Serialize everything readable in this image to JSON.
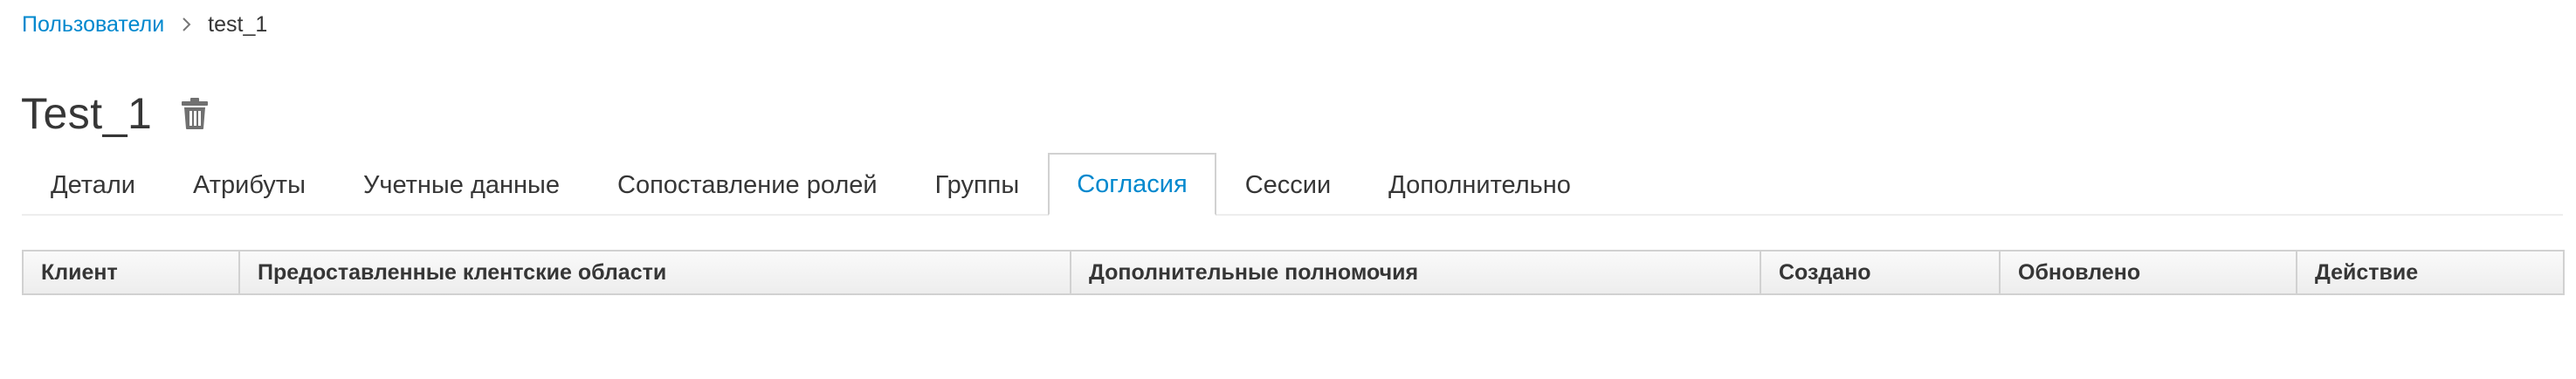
{
  "breadcrumb": {
    "parent": "Пользователи",
    "current": "test_1"
  },
  "header": {
    "title": "Test_1",
    "delete_icon": "trash-icon"
  },
  "tabs": [
    {
      "label": "Детали",
      "active": false
    },
    {
      "label": "Атрибуты",
      "active": false
    },
    {
      "label": "Учетные данные",
      "active": false
    },
    {
      "label": "Сопоставление ролей",
      "active": false
    },
    {
      "label": "Группы",
      "active": false
    },
    {
      "label": "Согласия",
      "active": true
    },
    {
      "label": "Сессии",
      "active": false
    },
    {
      "label": "Дополнительно",
      "active": false
    }
  ],
  "table": {
    "columns": [
      "Клиент",
      "Предоставленные клентские области",
      "Дополнительные полномочия",
      "Создано",
      "Обновлено",
      "Действие"
    ],
    "rows": []
  },
  "colors": {
    "link": "#0088ce",
    "text": "#363636",
    "border": "#d1d1d1"
  }
}
